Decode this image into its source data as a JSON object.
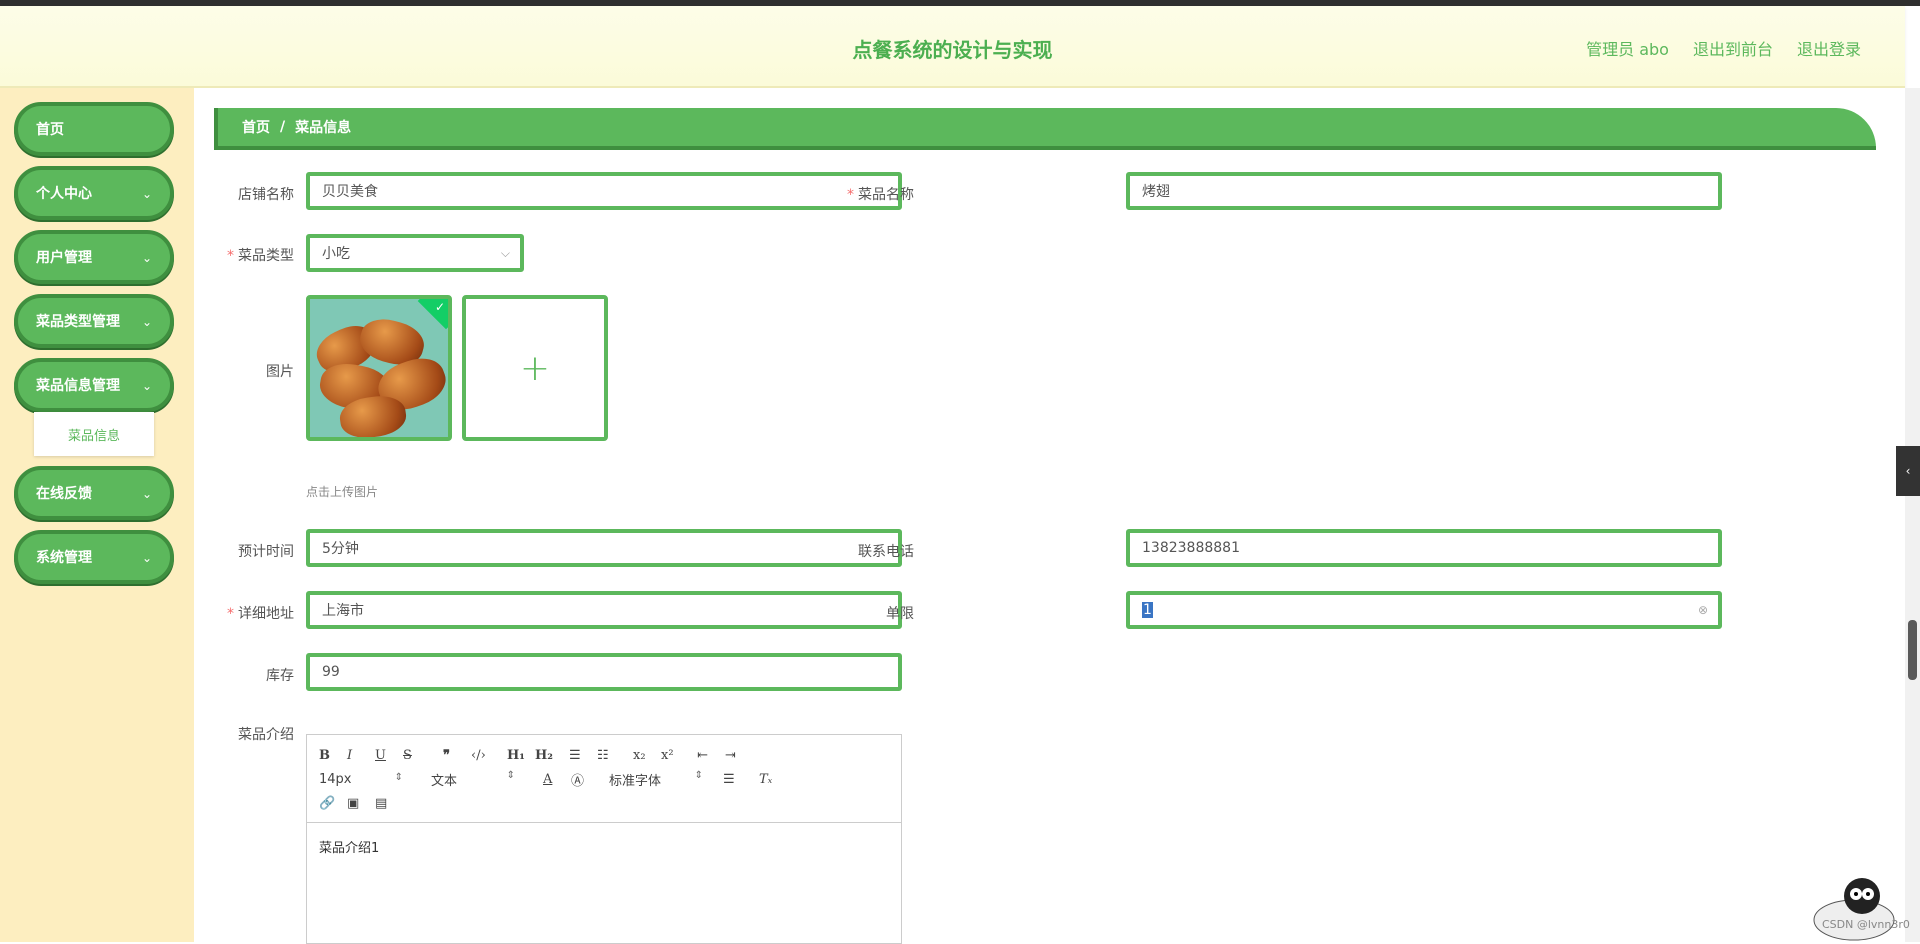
{
  "header": {
    "title": "点餐系统的设计与实现",
    "user": "管理员 abo",
    "to_front": "退出到前台",
    "logout": "退出登录"
  },
  "sidebar": {
    "items": [
      {
        "label": "首页"
      },
      {
        "label": "个人中心"
      },
      {
        "label": "用户管理"
      },
      {
        "label": "菜品类型管理"
      },
      {
        "label": "菜品信息管理"
      },
      {
        "label": "在线反馈"
      },
      {
        "label": "系统管理"
      }
    ],
    "submenu_active": "菜品信息",
    "chevron": "⌄"
  },
  "breadcrumb": {
    "home": "首页",
    "sep": "/",
    "current": "菜品信息"
  },
  "form": {
    "shop_name_label": "店铺名称",
    "shop_name_value": "贝贝美食",
    "dish_name_label": "菜品名称",
    "dish_name_value": "烤翅",
    "dish_type_label": "菜品类型",
    "dish_type_value": "小吃",
    "image_label": "图片",
    "upload_hint": "点击上传图片",
    "upload_plus": "+",
    "eta_label": "预计时间",
    "eta_value": "5分钟",
    "phone_label": "联系电话",
    "phone_value": "13823888881",
    "address_label": "详细地址",
    "address_value": "上海市",
    "limit_label": "单限",
    "limit_value": "1",
    "stock_label": "库存",
    "stock_value": "99",
    "intro_label": "菜品介绍",
    "required_mark": "*"
  },
  "editor": {
    "font_size": "14px",
    "text_style": "文本",
    "font_family": "标准字体",
    "content": "菜品介绍1"
  },
  "watermark": "CSDN @lvnn3r0",
  "colors": {
    "accent": "#5cb85c",
    "accent_dark": "#3f8f3f",
    "sidebar_bg": "#fdeec0",
    "required": "#f56c6c"
  }
}
